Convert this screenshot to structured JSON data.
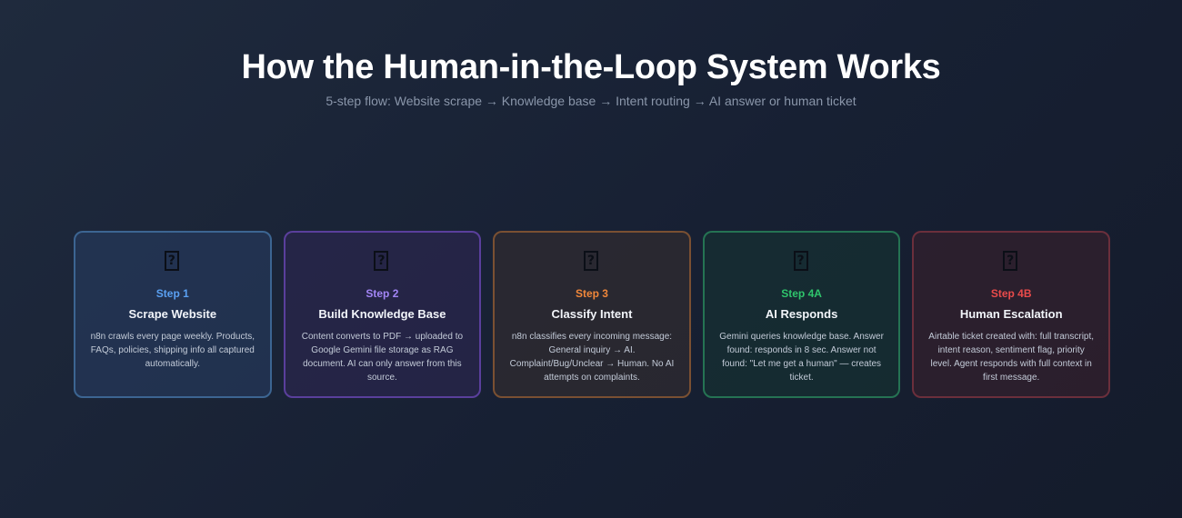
{
  "header": {
    "title": "How the Human-in-the-Loop System Works",
    "subtitle": "5-step flow: Website scrape → Knowledge base → Intent routing → AI answer or human ticket"
  },
  "steps": [
    {
      "icon": "missing-glyph-icon",
      "label": "Step 1",
      "title": "Scrape Website",
      "description": "n8n crawls every page weekly. Products, FAQs, policies, shipping info all captured automatically.",
      "accent": "#5aa0f2"
    },
    {
      "icon": "missing-glyph-icon",
      "label": "Step 2",
      "title": "Build Knowledge Base",
      "description": "Content converts to PDF → uploaded to Google Gemini file storage as RAG document. AI can only answer from this source.",
      "accent": "#a285f5"
    },
    {
      "icon": "missing-glyph-icon",
      "label": "Step 3",
      "title": "Classify Intent",
      "description": "n8n classifies every incoming message: General inquiry → AI. Complaint/Bug/Unclear → Human. No AI attempts on complaints.",
      "accent": "#f0873a"
    },
    {
      "icon": "missing-glyph-icon",
      "label": "Step 4A",
      "title": "AI Responds",
      "description": "Gemini queries knowledge base. Answer found: responds in 8 sec. Answer not found: \"Let me get a human\" — creates ticket.",
      "accent": "#2fc56c"
    },
    {
      "icon": "missing-glyph-icon",
      "label": "Step 4B",
      "title": "Human Escalation",
      "description": "Airtable ticket created with: full transcript, intent reason, sentiment flag, priority level. Agent responds with full context in first message.",
      "accent": "#ea4b4b"
    }
  ]
}
